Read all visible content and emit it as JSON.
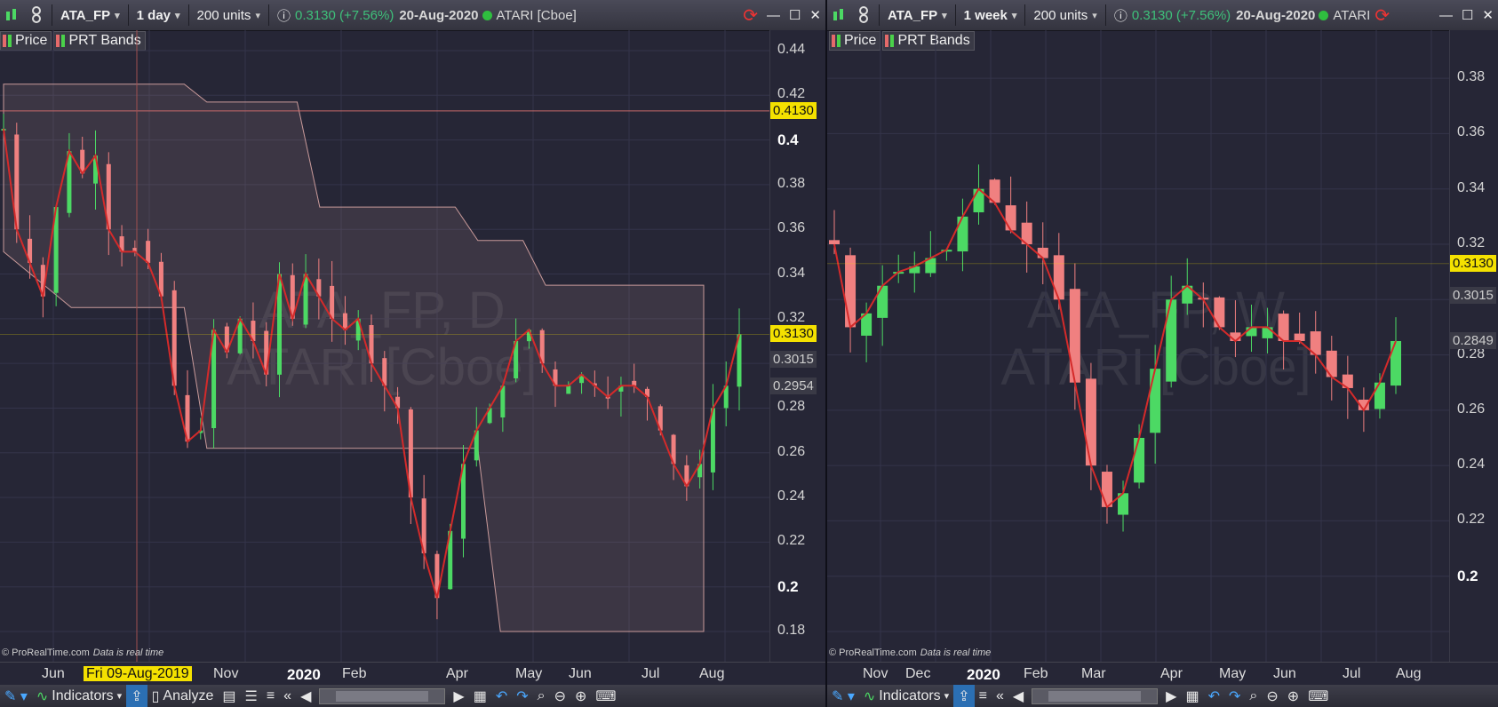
{
  "left": {
    "symbol": "ATA_FP",
    "timeframe": "1 day",
    "units": "200 units",
    "price_change": "0.3130 (+7.56%)",
    "date": "20-Aug-2020",
    "instrument": "ATARI [Cboe]",
    "legend": [
      "Price",
      "PRT Bands"
    ],
    "watermark_line1": "ATA_FP, D",
    "watermark_line2": "ATARI [Cboe]",
    "yticks": [
      "0.44",
      "0.42",
      "0.4",
      "0.38",
      "0.36",
      "0.34",
      "0.32",
      "0.30",
      "0.28",
      "0.26",
      "0.24",
      "0.22",
      "0.2",
      "0.18"
    ],
    "price_tags": [
      "0.4130",
      "0.3130",
      "0.3015",
      "0.2954",
      "0.2954"
    ],
    "xticks": [
      "Jun",
      "Nov",
      "2020",
      "Feb",
      "Apr",
      "May",
      "Jun",
      "Jul",
      "Aug"
    ],
    "crosshair_date": "Fri 09-Aug-2019",
    "copyright": "© ProRealTime.com",
    "realtime": "Data is real time",
    "bottom": [
      "Indicators",
      "Analyze"
    ]
  },
  "right": {
    "symbol": "ATA_FP",
    "timeframe": "1 week",
    "units": "200 units",
    "price_change": "0.3130 (+7.56%)",
    "date": "20-Aug-2020",
    "instrument": "ATARI",
    "legend": [
      "Price",
      "PRT Bands"
    ],
    "watermark_line1": "ATA_FP, W",
    "watermark_line2": "ATARI [Cboe]",
    "yticks": [
      "0.38",
      "0.36",
      "0.34",
      "0.32",
      "0.30",
      "0.28",
      "0.26",
      "0.24",
      "0.22",
      "0.2"
    ],
    "price_tags": [
      "0.3130",
      "0.3015",
      "0.2849"
    ],
    "xticks": [
      "Nov",
      "Dec",
      "2020",
      "Feb",
      "Mar",
      "Apr",
      "May",
      "Jun",
      "Jul",
      "Aug"
    ],
    "copyright": "© ProRealTime.com",
    "realtime": "Data is real time",
    "bottom": [
      "Indicators"
    ]
  },
  "colors": {
    "up": "#4cd964",
    "down": "#f08080",
    "ma": "#d42a2a",
    "band": "#c99a9a",
    "bg": "#262636",
    "tag_last": "#f4e100"
  },
  "chart_data": [
    {
      "type": "candlestick",
      "title": "ATA_FP, D",
      "ylim": [
        0.18,
        0.44
      ],
      "xlabel": "",
      "ylabel": "",
      "current": 0.313,
      "crosshair_level": 0.413,
      "close_path": [
        [
          0,
          0.405
        ],
        [
          1,
          0.36
        ],
        [
          2,
          0.345
        ],
        [
          3,
          0.33
        ],
        [
          4,
          0.37
        ],
        [
          5,
          0.395
        ],
        [
          6,
          0.385
        ],
        [
          7,
          0.393
        ],
        [
          8,
          0.36
        ],
        [
          9,
          0.35
        ],
        [
          10,
          0.35
        ],
        [
          11,
          0.345
        ],
        [
          12,
          0.33
        ],
        [
          13,
          0.29
        ],
        [
          14,
          0.265
        ],
        [
          15,
          0.27
        ],
        [
          16,
          0.315
        ],
        [
          17,
          0.305
        ],
        [
          18,
          0.32
        ],
        [
          19,
          0.31
        ],
        [
          20,
          0.295
        ],
        [
          21,
          0.34
        ],
        [
          22,
          0.32
        ],
        [
          23,
          0.34
        ],
        [
          24,
          0.33
        ],
        [
          25,
          0.32
        ],
        [
          26,
          0.315
        ],
        [
          27,
          0.32
        ],
        [
          28,
          0.3
        ],
        [
          29,
          0.29
        ],
        [
          30,
          0.28
        ],
        [
          31,
          0.24
        ],
        [
          32,
          0.215
        ],
        [
          33,
          0.195
        ],
        [
          34,
          0.225
        ],
        [
          35,
          0.255
        ],
        [
          36,
          0.27
        ],
        [
          37,
          0.28
        ],
        [
          38,
          0.29
        ],
        [
          39,
          0.31
        ],
        [
          40,
          0.315
        ],
        [
          41,
          0.3
        ],
        [
          42,
          0.29
        ],
        [
          43,
          0.29
        ],
        [
          44,
          0.295
        ],
        [
          45,
          0.29
        ],
        [
          46,
          0.285
        ],
        [
          47,
          0.29
        ],
        [
          48,
          0.29
        ],
        [
          49,
          0.285
        ],
        [
          50,
          0.27
        ],
        [
          51,
          0.255
        ],
        [
          52,
          0.245
        ],
        [
          53,
          0.255
        ],
        [
          54,
          0.28
        ],
        [
          55,
          0.29
        ],
        [
          56,
          0.313
        ]
      ],
      "upper_band": [
        [
          0,
          0.425
        ],
        [
          8,
          0.425
        ],
        [
          9,
          0.417
        ],
        [
          13,
          0.417
        ],
        [
          14,
          0.37
        ],
        [
          20,
          0.37
        ],
        [
          21,
          0.355
        ],
        [
          23,
          0.355
        ],
        [
          24,
          0.335
        ],
        [
          31,
          0.335
        ]
      ],
      "lower_band": [
        [
          0,
          0.35
        ],
        [
          3,
          0.325
        ],
        [
          8,
          0.325
        ],
        [
          9,
          0.262
        ],
        [
          16,
          0.262
        ],
        [
          17,
          0.262
        ],
        [
          21,
          0.262
        ],
        [
          22,
          0.18
        ],
        [
          31,
          0.18
        ]
      ]
    },
    {
      "type": "candlestick",
      "title": "ATA_FP, W",
      "ylim": [
        0.18,
        0.39
      ],
      "xlabel": "",
      "ylabel": "",
      "current": 0.313,
      "close_path": [
        [
          0,
          0.32
        ],
        [
          1,
          0.29
        ],
        [
          2,
          0.295
        ],
        [
          3,
          0.305
        ],
        [
          4,
          0.31
        ],
        [
          5,
          0.312
        ],
        [
          6,
          0.315
        ],
        [
          7,
          0.318
        ],
        [
          8,
          0.33
        ],
        [
          9,
          0.34
        ],
        [
          10,
          0.335
        ],
        [
          11,
          0.325
        ],
        [
          12,
          0.32
        ],
        [
          13,
          0.315
        ],
        [
          14,
          0.3
        ],
        [
          15,
          0.27
        ],
        [
          16,
          0.24
        ],
        [
          17,
          0.225
        ],
        [
          18,
          0.23
        ],
        [
          19,
          0.25
        ],
        [
          20,
          0.275
        ],
        [
          21,
          0.3
        ],
        [
          22,
          0.305
        ],
        [
          23,
          0.3
        ],
        [
          24,
          0.29
        ],
        [
          25,
          0.285
        ],
        [
          26,
          0.29
        ],
        [
          27,
          0.29
        ],
        [
          28,
          0.285
        ],
        [
          29,
          0.285
        ],
        [
          30,
          0.28
        ],
        [
          31,
          0.272
        ],
        [
          32,
          0.268
        ],
        [
          33,
          0.26
        ],
        [
          34,
          0.27
        ],
        [
          35,
          0.285
        ]
      ]
    }
  ]
}
